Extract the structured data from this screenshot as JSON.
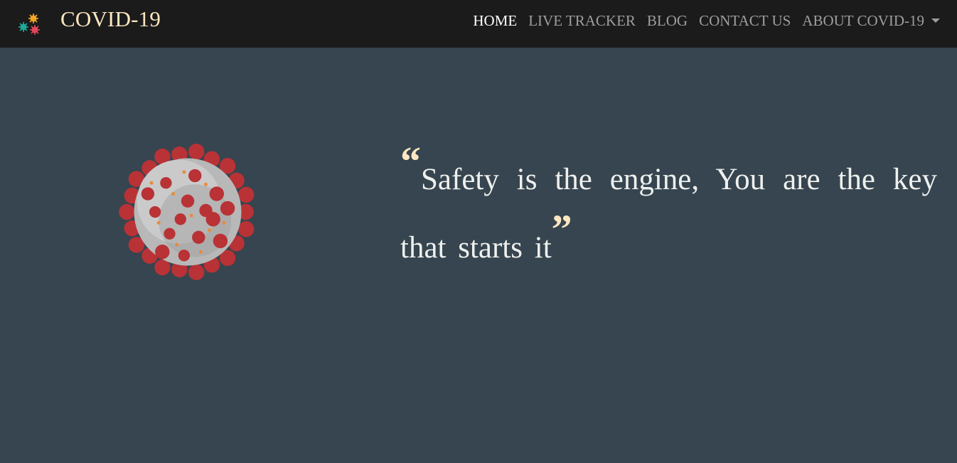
{
  "brand": {
    "title": "COVID-19",
    "icon": "virus-cluster-icon"
  },
  "nav": {
    "items": [
      {
        "label": "HOME",
        "active": true
      },
      {
        "label": "LIVE TRACKER",
        "active": false
      },
      {
        "label": "BLOG",
        "active": false
      },
      {
        "label": "CONTACT US",
        "active": false
      },
      {
        "label": "ABOUT COVID-19",
        "active": false,
        "dropdown": true
      }
    ]
  },
  "hero": {
    "image": "coronavirus-illustration",
    "quote_open": "“",
    "quote_text": "Safety is the engine, You are the key that starts it",
    "quote_close": "”"
  },
  "colors": {
    "background": "#36454f",
    "navbar": "#1b1b1b",
    "accent": "#fde6c0",
    "nav_inactive": "#9e9e9e",
    "virus_spike": "#b83236",
    "virus_body": "#b8b8b8"
  }
}
